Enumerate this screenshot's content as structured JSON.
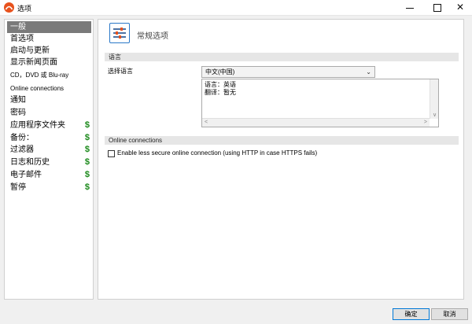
{
  "window": {
    "title": "选项"
  },
  "sidebar": {
    "items": [
      {
        "label": "一般"
      },
      {
        "label": "首选项"
      },
      {
        "label": "启动与更新"
      },
      {
        "label": "显示新闻页面"
      },
      {
        "label": "CD，DVD 或 Blu-ray"
      },
      {
        "label": "Online connections"
      },
      {
        "label": "通知"
      },
      {
        "label": "密码"
      },
      {
        "label": "应用程序文件夹",
        "badge": "$"
      },
      {
        "label": "备份：",
        "badge": "$"
      },
      {
        "label": "过滤器",
        "badge": "$"
      },
      {
        "label": "日志和历史",
        "badge": "$"
      },
      {
        "label": "电子邮件",
        "badge": "$"
      },
      {
        "label": "暂停",
        "badge": "$"
      }
    ]
  },
  "main": {
    "page_title": "常规选项",
    "language_section": {
      "title": "语言",
      "select_label": "选择语言",
      "selected_value": "中文(中国)",
      "info_lines": [
        "语言：英语",
        "翻译：暂无"
      ]
    },
    "online_section": {
      "title": "Online connections",
      "checkbox_label": "Enable less secure online connection (using HTTP in case HTTPS fails)",
      "checked": false
    }
  },
  "footer": {
    "ok_label": "确定",
    "cancel_label": "取消"
  },
  "colors": {
    "selected_bg": "#7a7a7a",
    "badge": "#1c8a1c",
    "accent": "#2a78c8",
    "app_icon": "#e8521d"
  }
}
